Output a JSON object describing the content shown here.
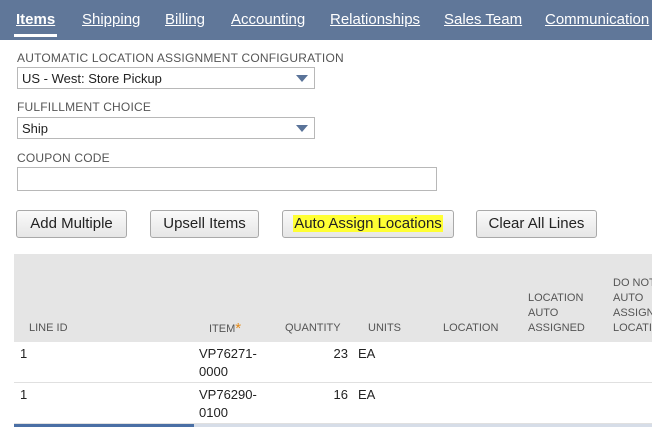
{
  "tabs": [
    {
      "label": "Items",
      "active": true
    },
    {
      "label": "Shipping"
    },
    {
      "label": "Billing"
    },
    {
      "label": "Accounting"
    },
    {
      "label": "Relationships"
    },
    {
      "label": "Sales Team"
    },
    {
      "label": "Communication"
    }
  ],
  "form": {
    "location_config_label": "AUTOMATIC LOCATION ASSIGNMENT CONFIGURATION",
    "location_config_value": "US - West: Store Pickup",
    "fulfillment_label": "FULFILLMENT CHOICE",
    "fulfillment_value": "Ship",
    "coupon_label": "COUPON CODE",
    "coupon_value": ""
  },
  "buttons": {
    "add_multiple": "Add Multiple",
    "upsell_items": "Upsell Items",
    "auto_assign": "Auto Assign Locations",
    "clear_all": "Clear All Lines"
  },
  "highlight_color": "#ffff33",
  "tabbar_color": "#607799",
  "grid": {
    "columns": {
      "line_id": "LINE ID",
      "item": "ITEM",
      "item_required": "*",
      "quantity": "QUANTITY",
      "units": "UNITS",
      "location": "LOCATION",
      "location_auto": [
        "LOCATION",
        "AUTO",
        "ASSIGNED"
      ],
      "do_not_auto": [
        "DO NOT",
        "AUTO",
        "ASSIGN",
        "LOCATION"
      ]
    },
    "rows": [
      {
        "line_id": "1",
        "item": [
          "VP76271-",
          "0000"
        ],
        "quantity": "23",
        "units": "EA"
      },
      {
        "line_id": "1",
        "item": [
          "VP76290-",
          "0100"
        ],
        "quantity": "16",
        "units": "EA"
      }
    ]
  }
}
